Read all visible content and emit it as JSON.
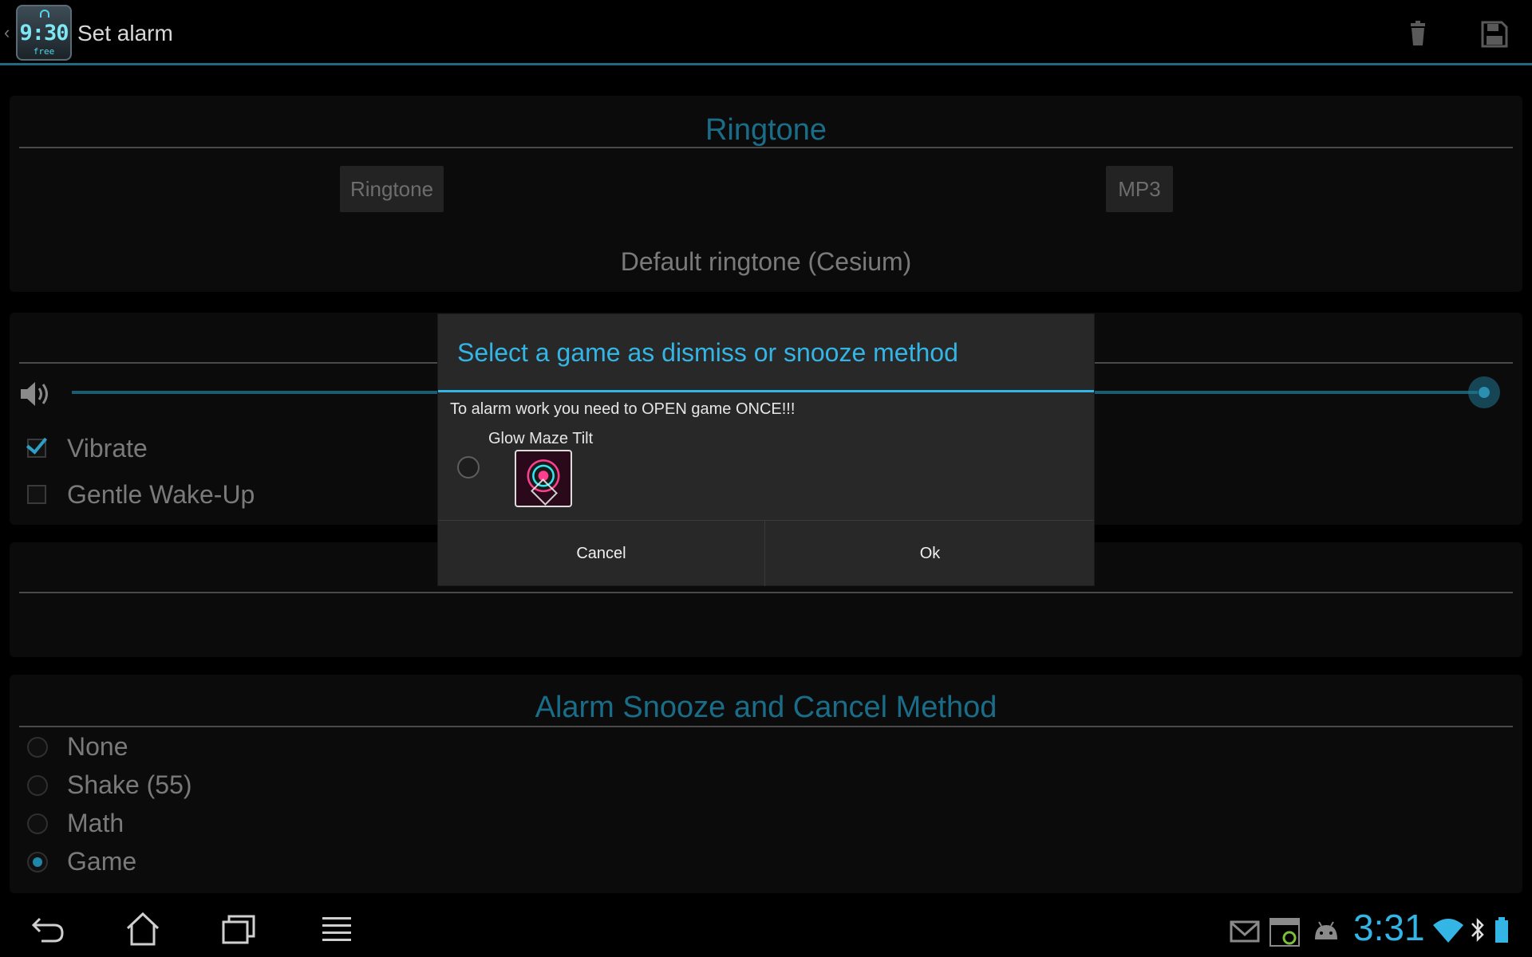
{
  "action_bar": {
    "app_icon": {
      "time": "9:30",
      "badge": "free"
    },
    "title": "Set alarm",
    "icons": [
      "back-chevron-icon",
      "trash-icon",
      "save-icon"
    ]
  },
  "ringtone": {
    "title": "Ringtone",
    "source_buttons": [
      "Ringtone",
      "MP3"
    ],
    "current": "Default ringtone (Cesium)"
  },
  "volume": {
    "level": 1.0,
    "checkboxes": [
      {
        "label": "Vibrate",
        "checked": true
      },
      {
        "label": "Gentle Wake-Up",
        "checked": false
      }
    ]
  },
  "snooze": {
    "title": "Alarm Snooze and Cancel Method",
    "options": [
      {
        "label": "None",
        "selected": false
      },
      {
        "label": "Shake (55)",
        "selected": false
      },
      {
        "label": "Math",
        "selected": false
      },
      {
        "label": "Game",
        "selected": true
      }
    ]
  },
  "dialog": {
    "title": "Select a game as dismiss or snooze method",
    "message": "To alarm work you need to OPEN game ONCE!!!",
    "game": {
      "name": "Glow Maze Tilt",
      "selected": false
    },
    "cancel_label": "Cancel",
    "ok_label": "Ok"
  },
  "system_bar": {
    "clock": "3:31",
    "nav": [
      "back-icon",
      "home-icon",
      "recent-apps-icon",
      "menu-icon"
    ],
    "notifications": [
      "gmail-icon",
      "screenshot-icon",
      "android-icon"
    ],
    "status": [
      "wifi-icon",
      "bluetooth-icon",
      "battery-icon"
    ]
  },
  "colors": {
    "accent": "#33b5e5",
    "section_title": "#1a6d88",
    "dialog_bg": "#282828",
    "background": "#000000"
  }
}
